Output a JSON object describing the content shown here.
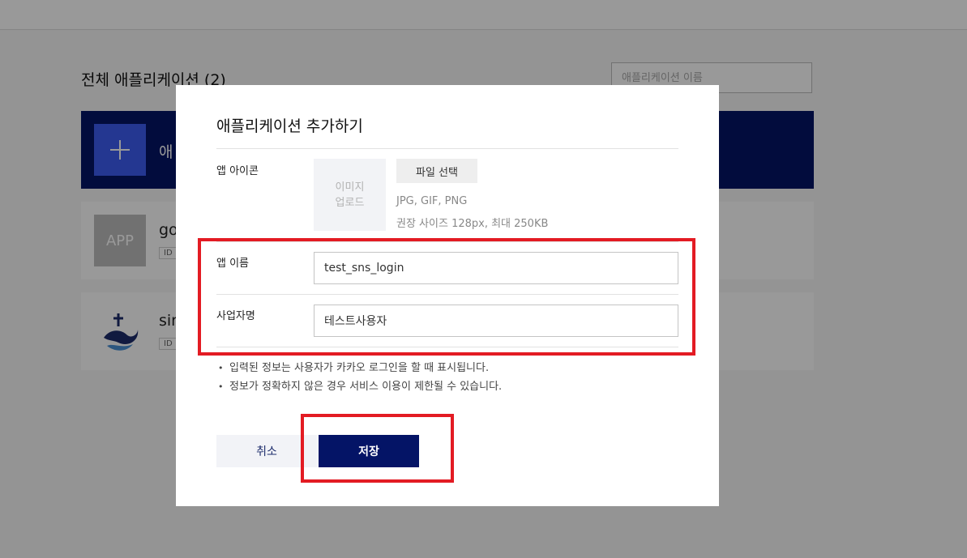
{
  "background": {
    "page_title": "전체 애플리케이션 (2)",
    "search_placeholder": "애플리케이션 이름",
    "add_card_label": "애",
    "apps": [
      {
        "thumb": "APP",
        "name": "go",
        "id_badge": "ID"
      },
      {
        "thumb": "app-logo-icon",
        "name": "sir",
        "id_badge": "ID"
      }
    ]
  },
  "modal": {
    "title": "애플리케이션 추가하기",
    "icon_field": {
      "label": "앱 아이콘",
      "upload_line1": "이미지",
      "upload_line2": "업로드",
      "file_button": "파일 선택",
      "hint_formats": "JPG, GIF, PNG",
      "hint_size": "권장 사이즈 128px, 최대 250KB"
    },
    "app_name": {
      "label": "앱 이름",
      "value": "test_sns_login"
    },
    "company_name": {
      "label": "사업자명",
      "value": "테스트사용자"
    },
    "notes": [
      "입력된 정보는 사용자가 카카오 로그인을 할 때 표시됩니다.",
      "정보가 정확하지 않은 경우 서비스 이용이 제한될 수 있습니다."
    ],
    "cancel_label": "취소",
    "save_label": "저장"
  },
  "colors": {
    "brand_navy": "#041466",
    "accent_blue": "#3c5cf2",
    "highlight_red": "#e31b23",
    "overlay": "rgba(0,0,0,0.40)"
  }
}
